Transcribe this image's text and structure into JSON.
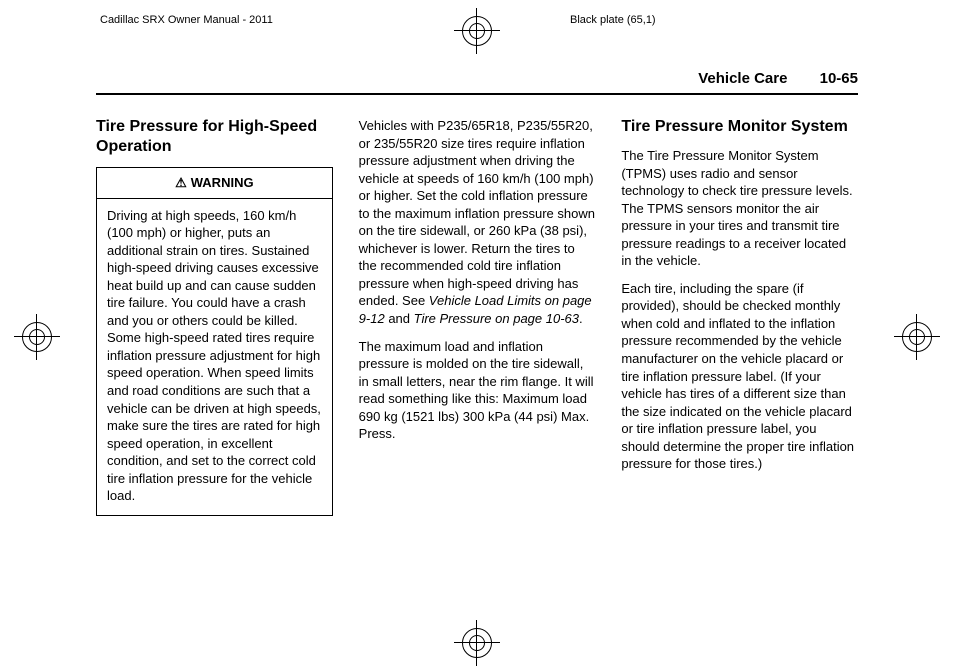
{
  "print_header": {
    "left": "Cadillac SRX Owner Manual - 2011",
    "right": "Black plate (65,1)"
  },
  "running_head": {
    "section": "Vehicle Care",
    "page": "10-65"
  },
  "col1": {
    "title": "Tire Pressure for High-Speed Operation",
    "warning_label": "WARNING",
    "warning_body": "Driving at high speeds, 160 km/h (100 mph) or higher, puts an additional strain on tires. Sustained high-speed driving causes excessive heat build up and can cause sudden tire failure. You could have a crash and you or others could be killed. Some high-speed rated tires require inflation pressure adjustment for high speed operation. When speed limits and road conditions are such that a vehicle can be driven at high speeds, make sure the tires are rated for high speed operation, in excellent condition, and set to the correct cold tire inflation pressure for the vehicle load."
  },
  "col2": {
    "p1_a": "Vehicles with P235/65R18, P235/55R20, or 235/55R20 size tires require inflation pressure adjustment when driving the vehicle at speeds of 160 km/h (100 mph) or higher. Set the cold inflation pressure to the maximum inflation pressure shown on the tire sidewall, or 260 kPa (38 psi), whichever is lower. Return the tires to the recommended cold tire inflation pressure when high-speed driving has ended. See ",
    "p1_ref1": "Vehicle Load Limits on page 9‑12",
    "p1_mid": " and ",
    "p1_ref2": "Tire Pressure on page 10‑63",
    "p1_end": ".",
    "p2": "The maximum load and inflation pressure is molded on the tire sidewall, in small letters, near the rim flange. It will read something like this: Maximum load 690 kg (1521 lbs) 300 kPa (44 psi) Max. Press."
  },
  "col3": {
    "title": "Tire Pressure Monitor System",
    "p1": "The Tire Pressure Monitor System (TPMS) uses radio and sensor technology to check tire pressure levels. The TPMS sensors monitor the air pressure in your tires and transmit tire pressure readings to a receiver located in the vehicle.",
    "p2": "Each tire, including the spare (if provided), should be checked monthly when cold and inflated to the inflation pressure recommended by the vehicle manufacturer on the vehicle placard or tire inflation pressure label. (If your vehicle has tires of a different size than the size indicated on the vehicle placard or tire inflation pressure label, you should determine the proper tire inflation pressure for those tires.)"
  }
}
